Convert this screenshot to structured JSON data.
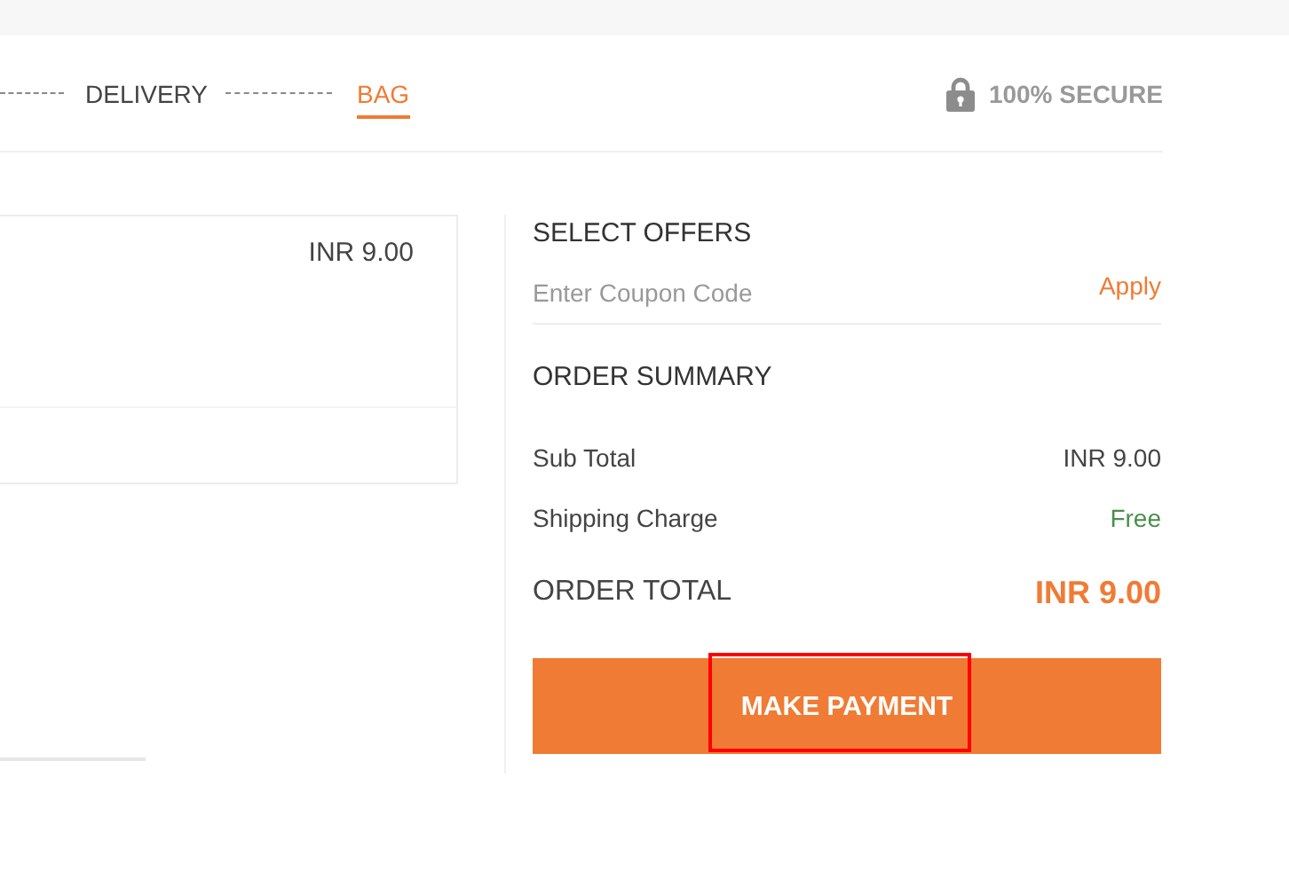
{
  "steps": [
    {
      "label": "DELIVERY",
      "selected": false
    },
    {
      "label": "BAG",
      "selected": true
    }
  ],
  "secure_label": "100% SECURE",
  "cart_item": {
    "price": "INR 9.00"
  },
  "offers": {
    "title": "SELECT OFFERS",
    "coupon": {
      "placeholder": "Enter Coupon Code"
    },
    "apply": "Apply"
  },
  "summary": {
    "title": "ORDER SUMMARY",
    "rows": [
      {
        "label": "Sub Total",
        "value": "INR 9.00",
        "kind": "plain"
      },
      {
        "label": "Shipping Charge",
        "value": "Free",
        "kind": "free"
      }
    ],
    "total_label": "ORDER TOTAL",
    "total_value": "INR 9.00"
  },
  "payment_button": {
    "label": "MAKE PAYMENT",
    "highlighted": true
  }
}
